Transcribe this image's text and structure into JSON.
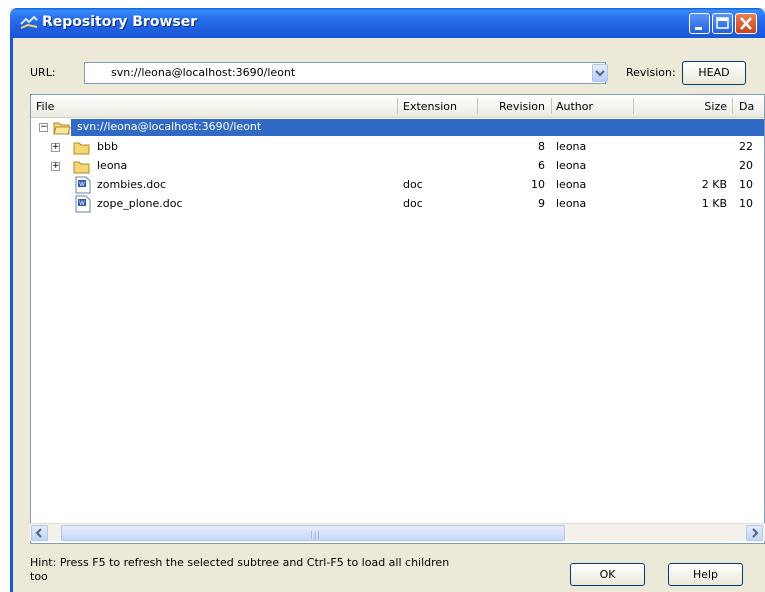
{
  "window": {
    "title": "Repository Browser"
  },
  "toolbar": {
    "url_label": "URL:",
    "url_value": "svn://leona@localhost:3690/leont",
    "revision_label": "Revision:",
    "revision_button": "HEAD"
  },
  "columns": [
    "File",
    "Extension",
    "Revision",
    "Author",
    "Size",
    "Da"
  ],
  "tree": {
    "root": {
      "name": "svn://leona@localhost:3690/leont",
      "expanded": true,
      "selected": true
    },
    "rows": [
      {
        "name": "bbb",
        "type": "folder",
        "extension": "",
        "revision": "8",
        "author": "leona",
        "size": "",
        "date": "22"
      },
      {
        "name": "leona",
        "type": "folder",
        "extension": "",
        "revision": "6",
        "author": "leona",
        "size": "",
        "date": "20"
      },
      {
        "name": "zombies.doc",
        "type": "doc",
        "extension": "doc",
        "revision": "10",
        "author": "leona",
        "size": "2 KB",
        "date": "10"
      },
      {
        "name": "zope_plone.doc",
        "type": "doc",
        "extension": "doc",
        "revision": "9",
        "author": "leona",
        "size": "1 KB",
        "date": "10"
      }
    ]
  },
  "footer": {
    "hint": "Hint: Press F5 to refresh the selected subtree and Ctrl-F5 to load all children too",
    "ok": "OK",
    "help": "Help"
  },
  "colors": {
    "titlebar": "#2a72ee",
    "selection": "#316ac5",
    "window_bg": "#ece9d8"
  }
}
